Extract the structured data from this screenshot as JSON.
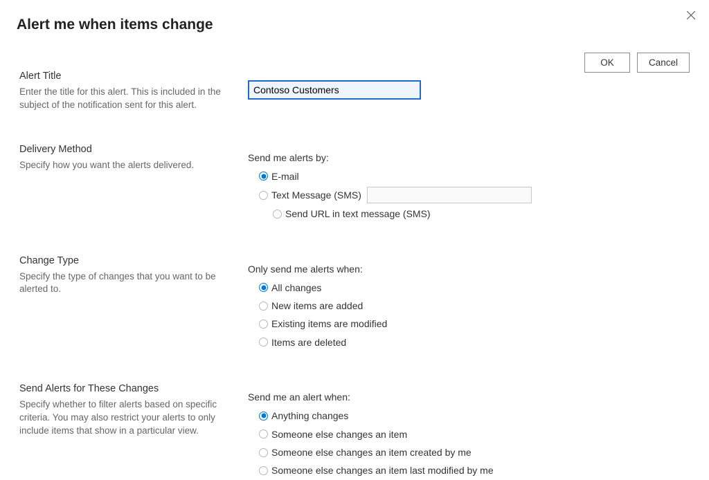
{
  "header": {
    "title": "Alert me when items change"
  },
  "buttons": {
    "ok": "OK",
    "cancel": "Cancel"
  },
  "sections": {
    "alertTitle": {
      "heading": "Alert Title",
      "description": "Enter the title for this alert. This is included in the subject of the notification sent for this alert.",
      "value": "Contoso Customers"
    },
    "deliveryMethod": {
      "heading": "Delivery Method",
      "description": "Specify how you want the alerts delivered.",
      "label": "Send me alerts by:",
      "options": {
        "email": "E-mail",
        "sms": "Text Message (SMS)",
        "sendUrl": "Send URL in text message (SMS)"
      },
      "selected": "email"
    },
    "changeType": {
      "heading": "Change Type",
      "description": "Specify the type of changes that you want to be alerted to.",
      "label": "Only send me alerts when:",
      "options": {
        "all": "All changes",
        "new": "New items are added",
        "modified": "Existing items are modified",
        "deleted": "Items are deleted"
      },
      "selected": "all"
    },
    "sendAlerts": {
      "heading": "Send Alerts for These Changes",
      "description": "Specify whether to filter alerts based on specific criteria. You may also restrict your alerts to only include items that show in a particular view.",
      "label": "Send me an alert when:",
      "options": {
        "anything": "Anything changes",
        "someoneElse": "Someone else changes an item",
        "someoneElseCreated": "Someone else changes an item created by me",
        "someoneElseModified": "Someone else changes an item last modified by me"
      },
      "selected": "anything"
    }
  }
}
